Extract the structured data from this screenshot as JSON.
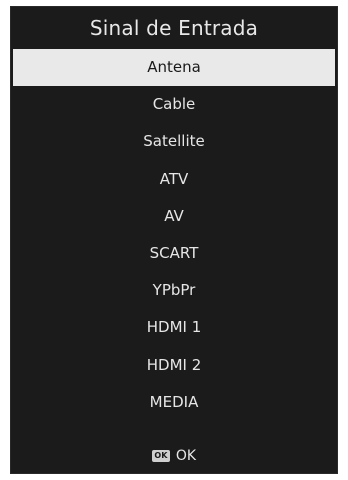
{
  "menu": {
    "title": "Sinal de Entrada",
    "selected_index": 0,
    "items": [
      {
        "label": "Antena"
      },
      {
        "label": "Cable"
      },
      {
        "label": "Satellite"
      },
      {
        "label": "ATV"
      },
      {
        "label": "AV"
      },
      {
        "label": "SCART"
      },
      {
        "label": "YPbPr"
      },
      {
        "label": "HDMI 1"
      },
      {
        "label": "HDMI 2"
      },
      {
        "label": "MEDIA"
      }
    ]
  },
  "footer": {
    "key_icon": "ok-key-icon",
    "key_text": "OK",
    "label": "OK"
  }
}
